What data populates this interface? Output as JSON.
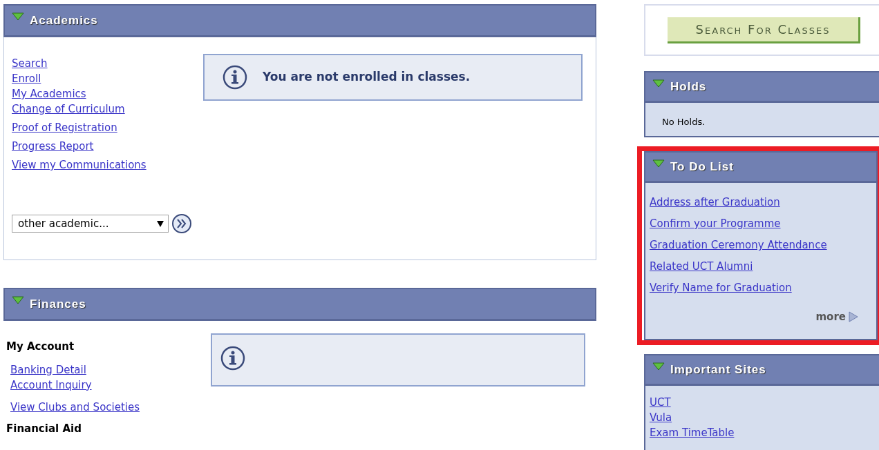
{
  "academics": {
    "title": "Academics",
    "expanded": true,
    "links": [
      "Search",
      "Enroll",
      "My Academics",
      "Change of Curriculum",
      "Proof of Registration",
      "Progress Report",
      "View my Communications"
    ],
    "info": "You are not enrolled in classes.",
    "select": {
      "value": "other academic..."
    }
  },
  "finances": {
    "title": "Finances",
    "expanded": true,
    "groups": [
      {
        "heading": "My Account",
        "links": [
          "Banking Detail",
          "Account Inquiry"
        ]
      },
      {
        "links": [
          "View Clubs and Societies"
        ]
      },
      {
        "heading": "Financial Aid"
      }
    ]
  },
  "search_button": "Search For Classes",
  "holds": {
    "title": "Holds",
    "expanded": true,
    "text": "No Holds."
  },
  "todo_list": {
    "title": "To Do List",
    "expanded": true,
    "highlighted": true,
    "links": [
      "Address after Graduation",
      "Confirm your Programme",
      "Graduation Ceremony Attendance",
      "Related UCT Alumni",
      "Verify Name for Graduation"
    ],
    "more": "more"
  },
  "important_sites": {
    "title": "Important Sites",
    "expanded": true,
    "links": [
      "UCT",
      "Vula",
      "Exam TimeTable"
    ]
  }
}
